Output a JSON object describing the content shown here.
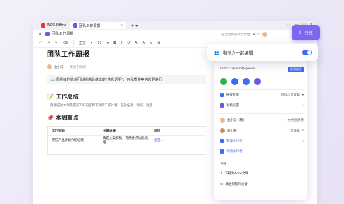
{
  "tabs": {
    "wps": "WPS Office",
    "doc": "团队工作周报"
  },
  "docbar": {
    "title": "团队工作周报",
    "status": "已自动保存到云文档"
  },
  "toolbar": {
    "style": "正文",
    "size": "11"
  },
  "share": {
    "label": "分享"
  },
  "document": {
    "title": "团队工作周报",
    "author": "金小溪",
    "updated": "更新于刚刚",
    "quote": "周报目的是给团队提供最基本的\"信息透明\"，自我质量等信息更进行",
    "section1_title": "工作总结",
    "section1_text": "简要描述本周完成的工作内容和下周的工作计划，包括任务、时间、进度",
    "section2_title": "本周重点",
    "table": {
      "headers": [
        "工作列举",
        "关键进展",
        "风险"
      ],
      "rows": [
        [
          "完成产品功能介绍切版",
          "确定文案初稿，完成各点功能梳理",
          "金亚..."
        ]
      ]
    }
  },
  "panel": {
    "invite_label": "和他人一起编辑",
    "link": "kdocs.cn/l/cmQ5Jeeee",
    "copy_label": "复制链接",
    "permission_label": "链接权限",
    "permission_value": "所有人可编辑",
    "advanced": "高级设置",
    "users": [
      {
        "name": "金小溪（我）",
        "role": "文件创建者"
      },
      {
        "name": "梁小萌",
        "role": "可编辑"
      }
    ],
    "manage": "管理协作者",
    "add": "添加协作者",
    "send_section": "发送",
    "download": "下载为docx文件",
    "send_device": "发送到我的设备"
  }
}
